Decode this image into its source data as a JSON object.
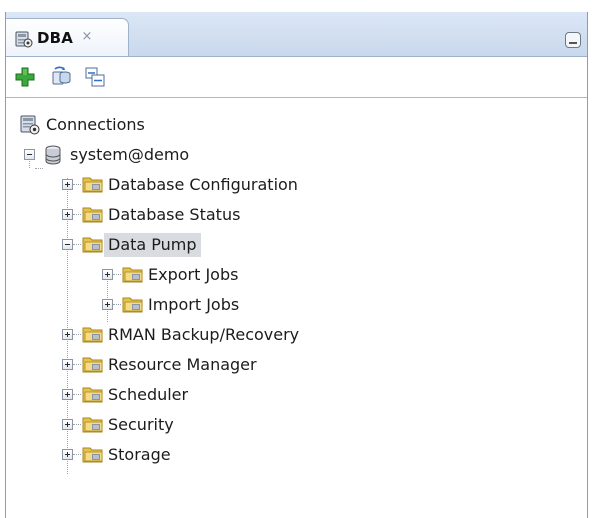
{
  "tab": {
    "title": "DBA",
    "close_glyph": "×"
  },
  "toolbar": {
    "add_icon": "add-connection-icon",
    "refresh_icon": "refresh-icon",
    "collapse_icon": "collapse-all-icon"
  },
  "tree": {
    "root": "Connections",
    "connection": "system@demo",
    "items": [
      "Database Configuration",
      "Database Status",
      "Data Pump",
      "RMAN Backup/Recovery",
      "Resource Manager",
      "Scheduler",
      "Security",
      "Storage"
    ],
    "data_pump_children": [
      "Export Jobs",
      "Import Jobs"
    ],
    "selected": "Data Pump"
  },
  "colors": {
    "folder": "#e7c24e",
    "selection": "#d8dbe0",
    "tab_bar": "#c9d8ec",
    "add_green": "#2e9a2e"
  }
}
